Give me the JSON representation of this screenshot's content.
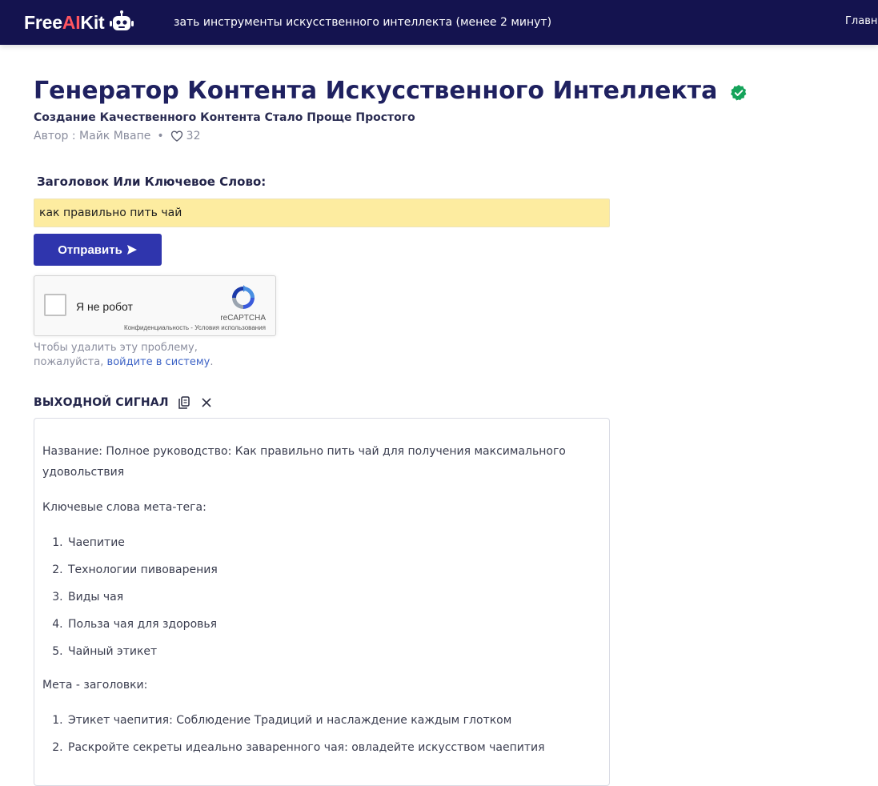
{
  "header": {
    "logo_prefix": "Free",
    "logo_ai": "AI",
    "logo_suffix": "Kit",
    "ticker": "зать инструменты искусственного интеллекта (менее 2 минут)",
    "nav_home": "Главна",
    "colors": {
      "bar": "#14134f",
      "logo_ai": "#ff5560"
    }
  },
  "page": {
    "title": "Генератор Контента Искусственного Интеллекта",
    "subtitle": "Создание Качественного Контента Стало Проще Простого",
    "author": "Автор : Майк Мвапе",
    "separator": "•",
    "likes": "32"
  },
  "form": {
    "label": "Заголовок Или Ключевое Слово:",
    "input_value": "как правильно пить чай",
    "submit_label": "Отправить"
  },
  "captcha": {
    "label": "Я не робот",
    "brand": "reCAPTCHA",
    "links": "Конфиденциальность - Условия использования"
  },
  "login_note": {
    "text_before": "Чтобы удалить эту проблему, пожалуйста, ",
    "link": "войдите в систему",
    "text_after": "."
  },
  "output": {
    "heading": "ВЫХОДНОЙ СИГНАЛ",
    "title_line": "Название: Полное руководство: Как правильно пить чай для получения максимального удовольствия",
    "keywords_label": "Ключевые слова мета-тега:",
    "keywords": [
      "Чаепитие",
      "Технологии пивоварения",
      "Виды чая",
      "Польза чая для здоровья",
      "Чайный этикет"
    ],
    "headings_label": "Мета - заголовки:",
    "headings": [
      "Этикет чаепития: Соблюдение Традиций и наслаждение каждым глотком",
      "Раскройте секреты идеально заваренного чая: овладейте искусством чаепития"
    ]
  }
}
